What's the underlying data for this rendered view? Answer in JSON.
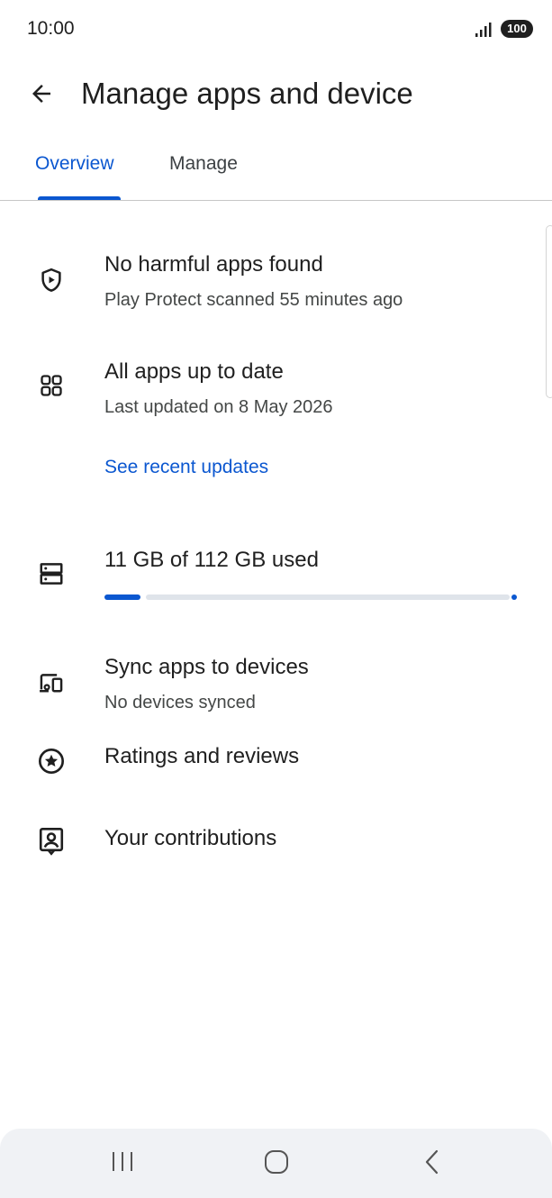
{
  "status_bar": {
    "time": "10:00",
    "battery": "100"
  },
  "app_bar": {
    "title": "Manage apps and device"
  },
  "tabs": [
    {
      "label": "Overview",
      "selected": true
    },
    {
      "label": "Manage",
      "selected": false
    }
  ],
  "overview": {
    "protect": {
      "title": "No harmful apps found",
      "subtitle": "Play Protect scanned 55 minutes ago",
      "icon": "shield-play-icon"
    },
    "updates": {
      "title": "All apps up to date",
      "subtitle": "Last updated on 8 May 2026",
      "link": "See recent updates",
      "icon": "apps-grid-icon"
    },
    "storage": {
      "title": "11 GB of 112 GB used",
      "used_gb": 11,
      "total_gb": 112,
      "icon": "storage-icon"
    },
    "sync": {
      "title": "Sync apps to devices",
      "subtitle": "No devices synced",
      "icon": "devices-icon"
    },
    "ratings": {
      "title": "Ratings and reviews",
      "icon": "star-circle-icon"
    },
    "contributions": {
      "title": "Your contributions",
      "icon": "contributions-icon"
    }
  },
  "colors": {
    "accent": "#0b57d0",
    "track": "#dfe4ea",
    "nav_bg": "#f0f2f5"
  }
}
